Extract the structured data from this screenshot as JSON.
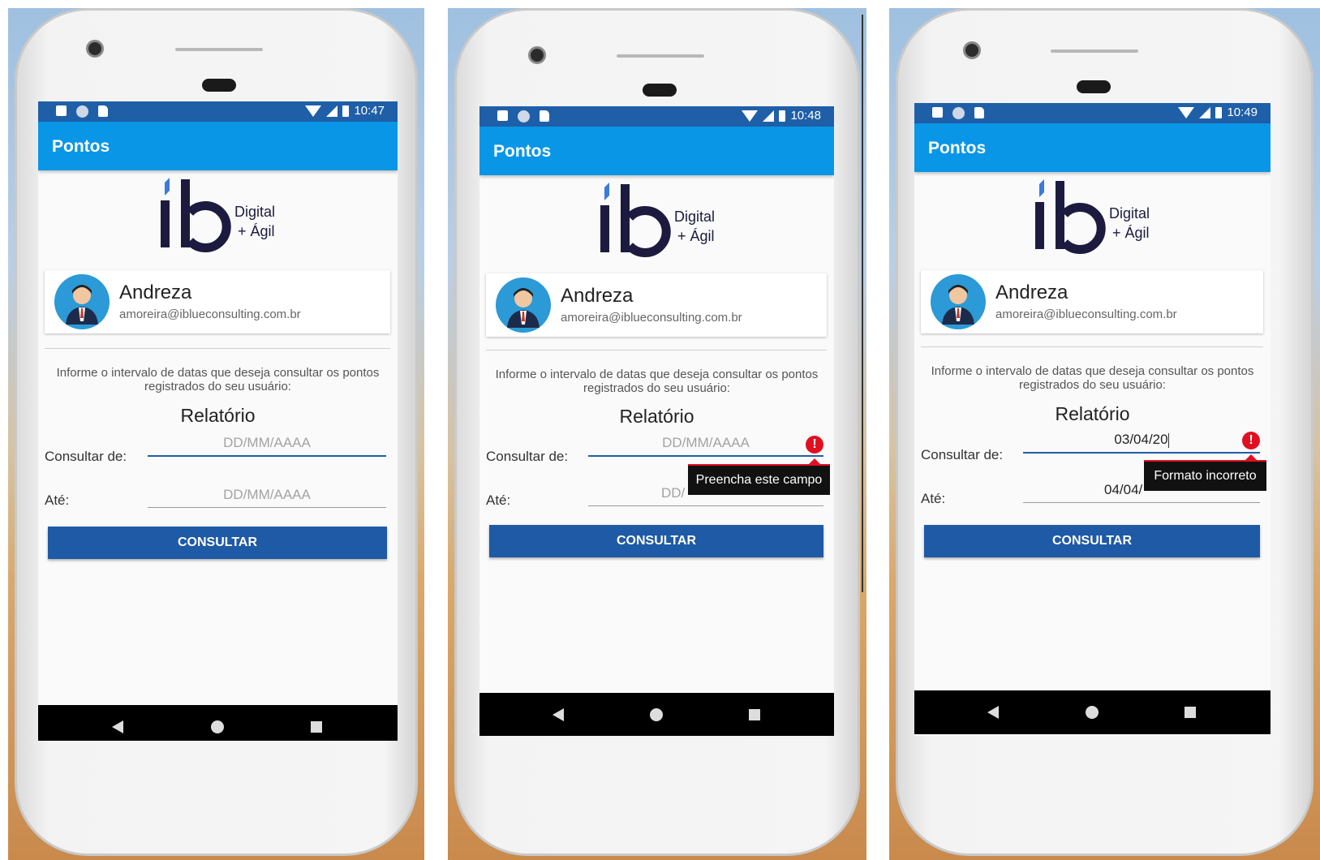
{
  "screens": [
    {
      "id": "screen1",
      "status_time": "10:47",
      "appbar_title": "Pontos",
      "logo": {
        "letters": "ib",
        "tagline_1": "Digital",
        "tagline_2": "+ Ágil"
      },
      "user": {
        "name": "Andreza",
        "email": "amoreira@iblueconsulting.com.br"
      },
      "instructions": "Informe o intervalo de datas que deseja consultar os pontos registrados do seu usuário:",
      "report_title": "Relatório",
      "from_label": "Consultar de:",
      "from_value": "",
      "from_placeholder": "DD/MM/AAAA",
      "to_label": "Até:",
      "to_value": "",
      "to_placeholder": "DD/MM/AAAA",
      "button_label": "CONSULTAR"
    },
    {
      "id": "screen2",
      "status_time": "10:48",
      "appbar_title": "Pontos",
      "logo": {
        "letters": "ib",
        "tagline_1": "Digital",
        "tagline_2": "+ Ágil"
      },
      "user": {
        "name": "Andreza",
        "email": "amoreira@iblueconsulting.com.br"
      },
      "instructions": "Informe o intervalo de datas que deseja consultar os pontos registrados do seu usuário:",
      "report_title": "Relatório",
      "from_label": "Consultar de:",
      "from_placeholder": "DD/MM/AAAA",
      "to_label": "Até:",
      "to_placeholder_visible": "DD/",
      "error_tooltip": "Preencha este campo",
      "button_label": "CONSULTAR"
    },
    {
      "id": "screen3",
      "status_time": "10:49",
      "appbar_title": "Pontos",
      "logo": {
        "letters": "ib",
        "tagline_1": "Digital",
        "tagline_2": "+ Ágil"
      },
      "user": {
        "name": "Andreza",
        "email": "amoreira@iblueconsulting.com.br"
      },
      "instructions": "Informe o intervalo de datas que deseja consultar os pontos registrados do seu usuário:",
      "report_title": "Relatório",
      "from_label": "Consultar de:",
      "from_value": "03/04/20",
      "to_label": "Até:",
      "to_value_visible": "04/04/",
      "error_tooltip": "Formato incorreto",
      "button_label": "CONSULTAR"
    }
  ],
  "colors": {
    "status_bar": "#1f5fa8",
    "app_bar": "#0a96e6",
    "button": "#1e5aa6",
    "error": "#e01020",
    "logo_navy": "#1c1b3f"
  }
}
